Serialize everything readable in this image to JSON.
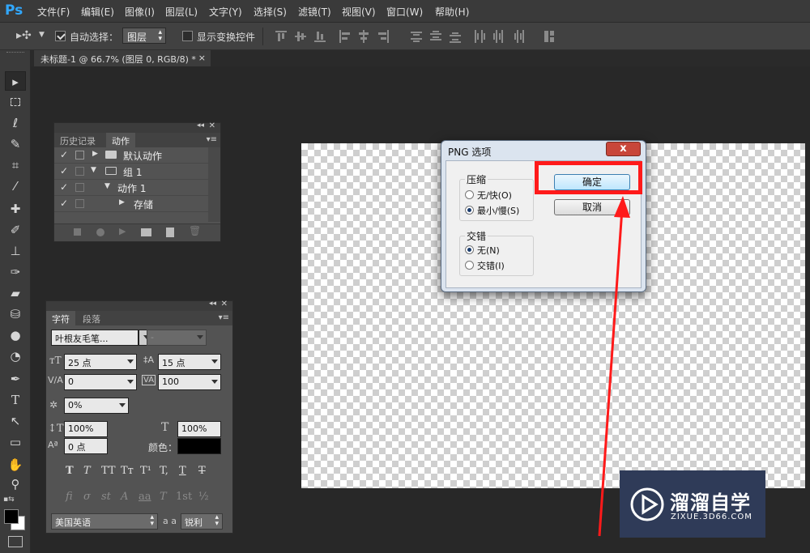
{
  "app": {
    "logo": "Ps"
  },
  "menu": [
    "文件(F)",
    "编辑(E)",
    "图像(I)",
    "图层(L)",
    "文字(Y)",
    "选择(S)",
    "滤镜(T)",
    "视图(V)",
    "窗口(W)",
    "帮助(H)"
  ],
  "options": {
    "auto_select_label": "自动选择：",
    "auto_select_checked": true,
    "auto_select_value": "图层",
    "show_transform_label": "显示变换控件",
    "show_transform_checked": false
  },
  "document_tab": {
    "title": "未标题-1 @ 66.7% (图层 0, RGB/8) *",
    "close": "×"
  },
  "actions_panel": {
    "tabs": [
      "历史记录",
      "动作"
    ],
    "active_tab": "动作",
    "items": [
      {
        "label": "默认动作",
        "level": 0,
        "expanded": false,
        "type": "folder"
      },
      {
        "label": "组 1",
        "level": 0,
        "expanded": true,
        "type": "folder"
      },
      {
        "label": "动作 1",
        "level": 1,
        "expanded": true,
        "type": "action"
      },
      {
        "label": "存储",
        "level": 2,
        "expanded": false,
        "type": "step"
      }
    ]
  },
  "char_panel": {
    "tabs": [
      "字符",
      "段落"
    ],
    "active_tab": "字符",
    "font_family": "叶根友毛笔...",
    "font_style": "-",
    "font_size": "25 点",
    "leading": "15 点",
    "kerning": "0",
    "tracking": "100",
    "tsume": "0%",
    "vertical_scale": "100%",
    "horizontal_scale": "100%",
    "baseline_shift": "0 点",
    "color_label": "颜色：",
    "color": "#000000",
    "style_buttons": [
      "T",
      "T",
      "TT",
      "Tт",
      "T¹",
      "T,",
      "T",
      "T"
    ],
    "opentype_buttons": [
      "fi",
      "σ",
      "st",
      "A",
      "aa",
      "T",
      "1st",
      "½"
    ],
    "language": "美国英语",
    "aa_label": "a a",
    "antialias": "锐利"
  },
  "dialog": {
    "title": "PNG 选项",
    "close": "x",
    "compression_label": "压缩",
    "compression_options": [
      "无/快(O)",
      "最小/慢(S)"
    ],
    "compression_selected": 1,
    "interlace_label": "交错",
    "interlace_options": [
      "无(N)",
      "交错(I)"
    ],
    "interlace_selected": 0,
    "ok_label": "确定",
    "cancel_label": "取消"
  },
  "watermark": {
    "name": "溜溜自学",
    "url": "ZIXUE.3D66.COM"
  },
  "colors": {
    "highlight": "#ff1a1a",
    "accent": "#31a8ff"
  }
}
